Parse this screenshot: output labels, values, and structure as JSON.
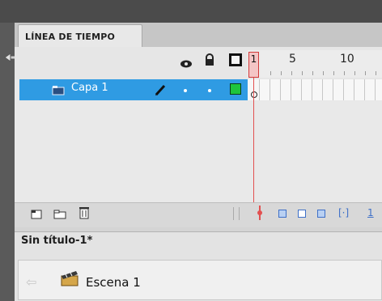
{
  "timeline": {
    "tab_label": "LÍNEA DE TIEMPO",
    "ruler_numbers": [
      "5",
      "10"
    ],
    "current_frame": "1"
  },
  "layer": {
    "name": "Capa 1"
  },
  "scene_panel": {
    "title": "Sin título-1*",
    "scene_name": "Escena 1"
  },
  "bottom_frame_label": "1",
  "colors": {
    "selection_blue": "#2f9be3",
    "playhead_red": "#e25050",
    "outline_green": "#1ec43c"
  }
}
